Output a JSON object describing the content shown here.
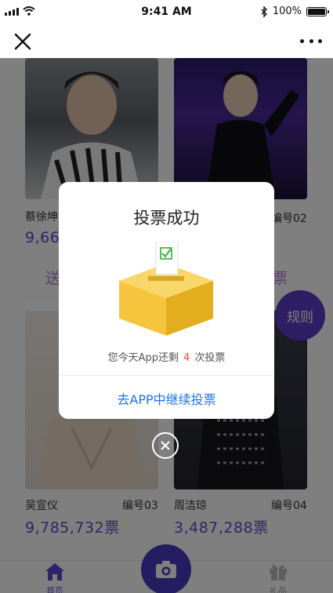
{
  "status_bar": {
    "time": "9:41 AM",
    "battery_text": "100%",
    "battery_level": 1.0
  },
  "nav": {
    "close_icon": "close-icon",
    "more_icon": "more-dots-icon"
  },
  "candidates": [
    {
      "name": "蔡徐坤",
      "number": "",
      "votes": "9,66",
      "vote_label": "送"
    },
    {
      "name": "",
      "number": "编号02",
      "votes": "",
      "vote_label": "票"
    },
    {
      "name": "吴宣仪",
      "number": "编号03",
      "votes": "9,785,732票"
    },
    {
      "name": "周洁琼",
      "number": "编号04",
      "votes": "3,487,288票"
    }
  ],
  "rules_button": {
    "label": "规则"
  },
  "tab_bar": {
    "home": {
      "label": "首页",
      "icon": "home-icon"
    },
    "camera": {
      "icon": "camera-icon"
    },
    "gift": {
      "label": "礼品",
      "icon": "gift-icon"
    }
  },
  "modal": {
    "title": "投票成功",
    "illustration": "ballot-box-icon",
    "remaining_prefix": "您今天App还剩",
    "remaining_count": "4",
    "remaining_suffix": "次投票",
    "link": "去APP中继续投票"
  },
  "colors": {
    "accent": "#5c4bd1",
    "link": "#1a73e8",
    "count": "#ff4444",
    "rules_bg": "#5c3fc9"
  }
}
